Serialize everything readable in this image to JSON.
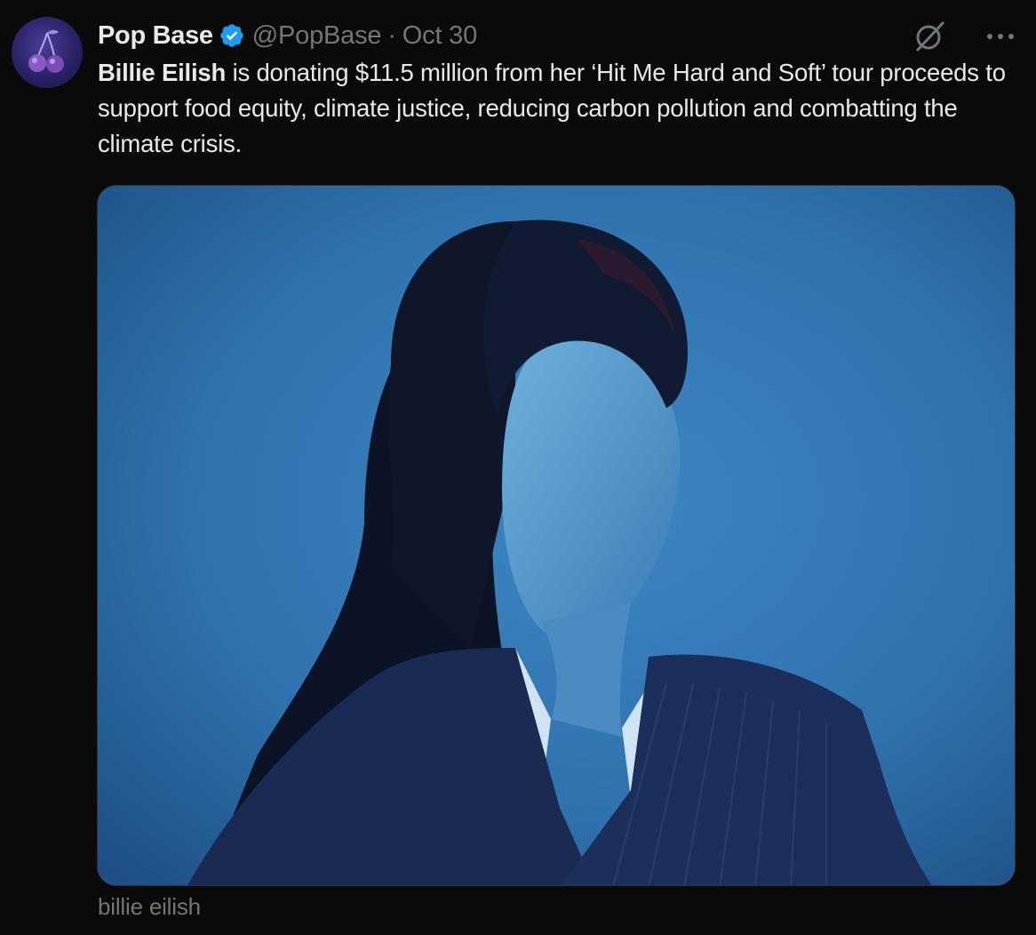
{
  "author": {
    "display_name": "Pop Base",
    "handle": "@PopBase",
    "separator": "·",
    "date": "Oct 30",
    "verified": true,
    "avatar_icon": "cherries-icon"
  },
  "tweet": {
    "mention": "Billie Eilish",
    "body": " is donating $11.5 million from her ‘Hit Me Hard and Soft’ tour proceeds to support food equity, climate justice, reducing carbon pollution and combatting the climate crisis."
  },
  "media": {
    "caption": "billie eilish",
    "background_color": "#2f72ad"
  },
  "actions": {
    "grok_icon": "grok-icon",
    "more_icon": "more-options-icon"
  },
  "colors": {
    "background": "#0a0a0a",
    "text_primary": "#e7e9ea",
    "text_secondary": "#71767b",
    "verified_blue": "#1d9bf0"
  }
}
